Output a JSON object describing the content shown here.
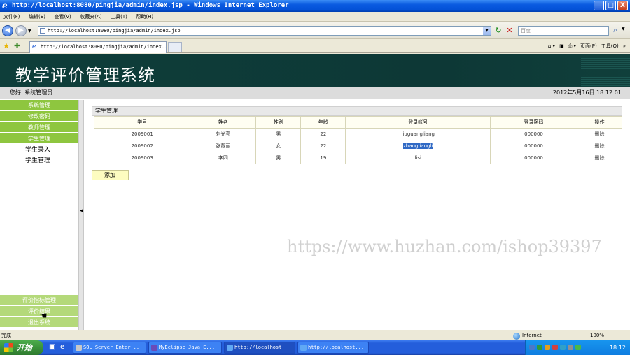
{
  "window": {
    "title": "http://localhost:8080/pingjia/admin/index.jsp - Windows Internet Explorer",
    "controls": [
      "_",
      "□",
      "X"
    ]
  },
  "menubar": [
    "文件(F)",
    "编辑(E)",
    "查看(V)",
    "收藏夹(A)",
    "工具(T)",
    "帮助(H)"
  ],
  "address": {
    "url": "http://localhost:8080/pingjia/admin/index.jsp",
    "search_placeholder": "百度"
  },
  "tab": {
    "title": "http://localhost:8080/pingjia/admin/index..."
  },
  "commandbar": {
    "page_label": "页面(P)",
    "tools_label": "工具(O)"
  },
  "app": {
    "title": "教学评价管理系统",
    "greeting": "您好:  系统管理员",
    "datetime": "2012年5月16日  18:12:01"
  },
  "sidebar": {
    "top_items": [
      {
        "label": "系统管理"
      },
      {
        "label": "修改密码"
      },
      {
        "label": "教师管理"
      },
      {
        "label": "学生管理"
      }
    ],
    "sub_items": [
      {
        "label": "学生录入"
      },
      {
        "label": "学生管理"
      }
    ],
    "bottom_items": [
      {
        "label": "评价指标管理"
      },
      {
        "label": "评价结果"
      },
      {
        "label": "退出系统"
      }
    ]
  },
  "panel": {
    "title": "学生管理"
  },
  "table": {
    "headers": [
      "学号",
      "姓名",
      "性别",
      "年龄",
      "登录帐号",
      "登录密码",
      "操作"
    ],
    "rows": [
      [
        "2009001",
        "刘光亮",
        "男",
        "22",
        "liuguangliang",
        "000000",
        "删除"
      ],
      [
        "2009002",
        "张靓丽",
        "女",
        "22",
        "zhangliangli",
        "000000",
        "删除"
      ],
      [
        "2009003",
        "李四",
        "男",
        "19",
        "lisi",
        "000000",
        "删除"
      ]
    ]
  },
  "add_button": "添加",
  "watermark": "https://www.huzhan.com/ishop39397",
  "statusbar": {
    "status": "完成",
    "zone": "Internet",
    "zoom": "100%"
  },
  "taskbar": {
    "start": "开始",
    "tasks": [
      {
        "label": "SQL Server Enter..."
      },
      {
        "label": "MyEclipse Java E..."
      },
      {
        "label": "http://localhost"
      },
      {
        "label": "http://localhost..."
      }
    ],
    "clock": "18:12"
  },
  "colors": {
    "banner": "#0e3e3a",
    "menu_green": "#8ec63f",
    "menu_green_light": "#b4d97a",
    "selection": "#316ac5"
  }
}
